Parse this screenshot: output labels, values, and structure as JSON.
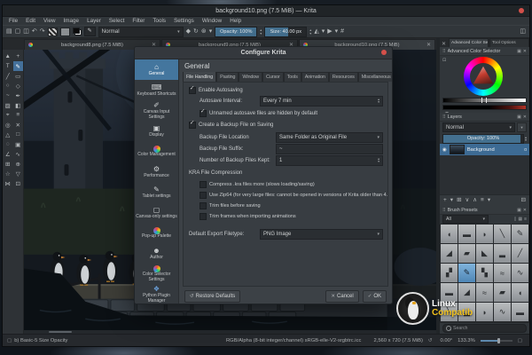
{
  "window": {
    "title": "background10.png (7.5 MiB) — Krita",
    "menu": [
      "File",
      "Edit",
      "View",
      "Image",
      "Layer",
      "Select",
      "Filter",
      "Tools",
      "Settings",
      "Window",
      "Help"
    ],
    "toolbar": {
      "blend_mode": "Normal",
      "opacity": "Opacity: 100%",
      "size": "Size: 40.00 px"
    },
    "toolbar_icons_left": [
      {
        "name": "new-document-icon",
        "g": "▤"
      },
      {
        "name": "open-document-icon",
        "g": "▢"
      },
      {
        "name": "save-icon",
        "g": "◫"
      },
      {
        "name": "undo-icon",
        "g": "↶"
      },
      {
        "name": "redo-icon",
        "g": "↷"
      }
    ],
    "toolbar_icons_mid": [
      {
        "name": "eraser-icon",
        "g": "◆"
      },
      {
        "name": "reload-preset-icon",
        "g": "↻"
      },
      {
        "name": "reset-values-icon",
        "g": "⊛"
      },
      {
        "name": "dropdown-icon",
        "g": "▾"
      }
    ],
    "toolbar_icons_right": [
      {
        "name": "mirror-icon",
        "g": "◭"
      },
      {
        "name": "dropdown-icon",
        "g": "▾"
      },
      {
        "name": "gradient-flag-icon",
        "g": "▶"
      },
      {
        "name": "dropdown-icon",
        "g": "▾"
      },
      {
        "name": "crop-icon",
        "g": "#"
      }
    ],
    "workspace_icon": "◫",
    "doc_tabs": [
      {
        "label": "background8.png (7.5 MiB)",
        "close": "✕",
        "active": false
      },
      {
        "label": "background9.png (7.5 MiB)",
        "close": "✕",
        "active": false
      },
      {
        "label": "background10.png (7.5 MiB)",
        "close": "✕",
        "active": true
      }
    ]
  },
  "toolbox": {
    "tools": [
      {
        "g": "▲",
        "sel": false
      },
      {
        "g": "+",
        "sel": false
      },
      {
        "g": "T",
        "sel": false
      },
      {
        "g": "✎",
        "sel": true
      },
      {
        "g": "╱",
        "sel": false
      },
      {
        "g": "▭",
        "sel": false
      },
      {
        "g": "○",
        "sel": false
      },
      {
        "g": "◇",
        "sel": false
      },
      {
        "g": "~",
        "sel": false
      },
      {
        "g": "✒",
        "sel": false
      },
      {
        "g": "▨",
        "sel": false
      },
      {
        "g": "◧",
        "sel": false
      },
      {
        "g": "⌖",
        "sel": false
      },
      {
        "g": "≡",
        "sel": false
      },
      {
        "g": "◎",
        "sel": false
      },
      {
        "g": "✕",
        "sel": false
      },
      {
        "g": "△",
        "sel": false
      },
      {
        "g": "□",
        "sel": false
      },
      {
        "g": "◌",
        "sel": false
      },
      {
        "g": "▣",
        "sel": false
      },
      {
        "g": "∠",
        "sel": false
      },
      {
        "g": "∿",
        "sel": false
      },
      {
        "g": "⊞",
        "sel": false
      },
      {
        "g": "⊕",
        "sel": false
      },
      {
        "g": "☆",
        "sel": false
      },
      {
        "g": "▽",
        "sel": false
      },
      {
        "g": "⋈",
        "sel": false
      },
      {
        "g": "⊡",
        "sel": false
      }
    ]
  },
  "dialog": {
    "title": "Configure Krita",
    "heading": "General",
    "sidebar": [
      {
        "icon": "⌂",
        "label": "General",
        "selected": true,
        "wheel": false,
        "py": false
      },
      {
        "icon": "⌨",
        "label": "Keyboard Shortcuts",
        "selected": false,
        "wheel": false,
        "py": false
      },
      {
        "icon": "✐",
        "label": "Canvas Input Settings",
        "selected": false,
        "wheel": false,
        "py": false
      },
      {
        "icon": "▣",
        "label": "Display",
        "selected": false,
        "wheel": false,
        "py": false
      },
      {
        "icon": "",
        "label": "Color Management",
        "selected": false,
        "wheel": true,
        "py": false
      },
      {
        "icon": "⚙",
        "label": "Performance",
        "selected": false,
        "wheel": false,
        "py": false
      },
      {
        "icon": "✎",
        "label": "Tablet settings",
        "selected": false,
        "wheel": false,
        "py": false
      },
      {
        "icon": "▢",
        "label": "Canvas-only settings",
        "selected": false,
        "wheel": false,
        "py": false
      },
      {
        "icon": "",
        "label": "Pop-up Palette",
        "selected": false,
        "wheel": true,
        "py": false
      },
      {
        "icon": "☻",
        "label": "Author",
        "selected": false,
        "wheel": false,
        "py": false
      },
      {
        "icon": "",
        "label": "Color Selector Settings",
        "selected": false,
        "wheel": true,
        "py": false
      },
      {
        "icon": "❖",
        "label": "Python Plugin Manager",
        "selected": false,
        "wheel": false,
        "py": true
      }
    ],
    "tabs": [
      {
        "label": "File Handling",
        "selected": true
      },
      {
        "label": "Pasting",
        "selected": false
      },
      {
        "label": "Window",
        "selected": false
      },
      {
        "label": "Cursor",
        "selected": false
      },
      {
        "label": "Tools",
        "selected": false
      },
      {
        "label": "Animation",
        "selected": false
      },
      {
        "label": "Resources",
        "selected": false
      },
      {
        "label": "Miscellaneous",
        "selected": false
      }
    ],
    "form": {
      "enable_autosaving": {
        "label": "Enable Autosaving",
        "check": "✓"
      },
      "autosave_interval": {
        "label": "Autosave Interval:",
        "value": "Every 7 min"
      },
      "hidden_autosave": {
        "label": "Unnamed autosave files are hidden by default",
        "check": "✓"
      },
      "create_backup": {
        "label": "Create a Backup File on Saving",
        "check": "✓"
      },
      "backup_location": {
        "label": "Backup File Location",
        "value": "Same Folder as Original File"
      },
      "backup_suffix": {
        "label": "Backup File Suffix:",
        "value": "~"
      },
      "backup_kept": {
        "label": "Number of Backup Files Kept:",
        "value": "1"
      },
      "kra_section": "KRA File Compression",
      "kra_options": [
        {
          "label": "Compress .kra files more (slows loading/saving)",
          "check": ""
        },
        {
          "label": "Use Zip64 (for very large files: cannot be opened in versions of Krita older than 4.2.0)",
          "check": ""
        },
        {
          "label": "Trim files before saving",
          "check": ""
        },
        {
          "label": "Trim frames when importing animations",
          "check": ""
        }
      ],
      "default_export": {
        "label": "Default Export Filetype:",
        "value": "PNG Image"
      }
    },
    "buttons": {
      "restore": "Restore Defaults",
      "cancel": "Cancel",
      "ok": "OK"
    }
  },
  "right_panel": {
    "dock_tabs": [
      {
        "label": "Advanced Color Selector",
        "selected": true
      },
      {
        "label": "Tool Options",
        "selected": false
      }
    ],
    "acs": {
      "title": "Advanced Color Selector"
    },
    "layers": {
      "title": "Layers",
      "blend_mode": "Normal",
      "opacity": "Opacity: 100%",
      "layer_name": "Background"
    },
    "layer_tools": [
      "+",
      "▾",
      "⊞",
      "∨",
      "∧",
      "≡",
      "▾",
      "⊟"
    ],
    "brushes": {
      "title": "Brush Presets",
      "filter": "All",
      "search": "Search",
      "cells": [
        {
          "g": "◖",
          "sel": false
        },
        {
          "g": "▬",
          "sel": false
        },
        {
          "g": "◗",
          "sel": false
        },
        {
          "g": "╲",
          "sel": false
        },
        {
          "g": "✎",
          "sel": false
        },
        {
          "g": "◢",
          "sel": false
        },
        {
          "g": "▰",
          "sel": false
        },
        {
          "g": "◣",
          "sel": false
        },
        {
          "g": "▂",
          "sel": false
        },
        {
          "g": "╱",
          "sel": false
        },
        {
          "g": "▞",
          "sel": false
        },
        {
          "g": "✎",
          "sel": true
        },
        {
          "g": "▚",
          "sel": false
        },
        {
          "g": "≈",
          "sel": false
        },
        {
          "g": "∿",
          "sel": false
        },
        {
          "g": "▬",
          "sel": false
        },
        {
          "g": "◢",
          "sel": false
        },
        {
          "g": "≈",
          "sel": false
        },
        {
          "g": "▰",
          "sel": false
        },
        {
          "g": "◖",
          "sel": false
        },
        {
          "g": "╲",
          "sel": false
        },
        {
          "g": "▂",
          "sel": false
        },
        {
          "g": "◗",
          "sel": false
        },
        {
          "g": "∿",
          "sel": false
        },
        {
          "g": "▬",
          "sel": false
        }
      ]
    }
  },
  "status_bar": {
    "brush": "b) Basic-5 Size Opacity",
    "color_profile": "RGB/Alpha (8-bit integer/channel)  sRGB-elle-V2-srgbtrc.icc",
    "size": "2,560 x 720 (7.5 MiB)",
    "angle": "0.00°",
    "zoom": "133.3%"
  },
  "watermark": {
    "line1": "Linux",
    "line2": "Compatib"
  }
}
